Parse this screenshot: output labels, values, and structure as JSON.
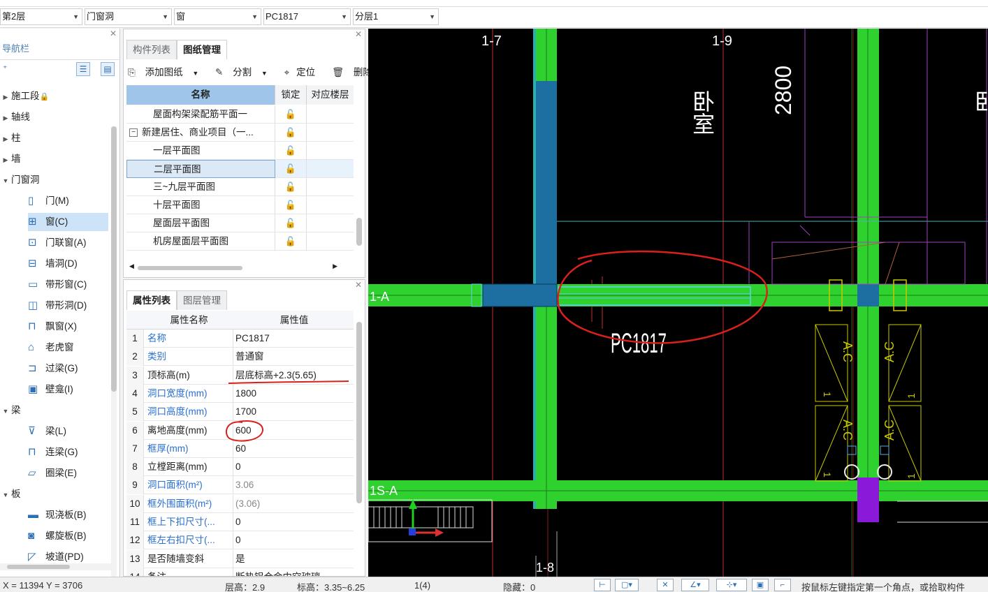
{
  "toolbar": {
    "floor": "第2层",
    "category": "门窗洞",
    "type": "窗",
    "component": "PC1817",
    "layer": "分层1"
  },
  "nav": {
    "title": "导航栏",
    "items": [
      {
        "label": "施工段",
        "expanded": false,
        "icon": "lock-icon"
      },
      {
        "label": "轴线",
        "expanded": false
      },
      {
        "label": "柱",
        "expanded": false
      },
      {
        "label": "墙",
        "expanded": false
      },
      {
        "label": "门窗洞",
        "expanded": true
      },
      {
        "label": "门(M)",
        "icon": "door-icon"
      },
      {
        "label": "窗(C)",
        "icon": "window-icon",
        "selected": true
      },
      {
        "label": "门联窗(A)",
        "icon": "door-window-icon"
      },
      {
        "label": "墙洞(D)",
        "icon": "wall-opening-icon"
      },
      {
        "label": "带形窗(C)",
        "icon": "strip-window-icon"
      },
      {
        "label": "带形洞(D)",
        "icon": "strip-opening-icon"
      },
      {
        "label": "飘窗(X)",
        "icon": "bay-window-icon"
      },
      {
        "label": "老虎窗",
        "icon": "dormer-icon"
      },
      {
        "label": "过梁(G)",
        "icon": "lintel-icon"
      },
      {
        "label": "壁龛(I)",
        "icon": "niche-icon"
      },
      {
        "label": "梁",
        "expanded": true
      },
      {
        "label": "梁(L)",
        "icon": "beam-icon"
      },
      {
        "label": "连梁(G)",
        "icon": "coupling-beam-icon"
      },
      {
        "label": "圈梁(E)",
        "icon": "ring-beam-icon"
      },
      {
        "label": "板",
        "expanded": true
      },
      {
        "label": "现浇板(B)",
        "icon": "slab-icon"
      },
      {
        "label": "螺旋板(B)",
        "icon": "spiral-slab-icon"
      },
      {
        "label": "坡道(PD)",
        "icon": "ramp-icon"
      }
    ]
  },
  "drawing_panel": {
    "tabs": [
      "构件列表",
      "图纸管理"
    ],
    "active_tab": 1,
    "tools": {
      "add": "添加图纸",
      "split": "分割",
      "locate": "定位",
      "delete": "删除"
    },
    "columns": [
      "名称",
      "锁定",
      "对应楼层"
    ],
    "rows": [
      {
        "name": "屋面构架梁配筋平面一",
        "indent": 1
      },
      {
        "name": "新建居住、商业项目（一...",
        "indent": 0,
        "group": true
      },
      {
        "name": "一层平面图",
        "indent": 1
      },
      {
        "name": "二层平面图",
        "indent": 1,
        "selected": true
      },
      {
        "name": "三~九层平面图",
        "indent": 1
      },
      {
        "name": "十层平面图",
        "indent": 1
      },
      {
        "name": "屋面层平面图",
        "indent": 1
      },
      {
        "name": "机房屋面层平面图",
        "indent": 1
      }
    ]
  },
  "prop_panel": {
    "tabs": [
      "属性列表",
      "图层管理"
    ],
    "active_tab": 0,
    "columns": [
      "属性名称",
      "属性值"
    ],
    "rows": [
      {
        "n": "1",
        "name": "名称",
        "value": "PC1817",
        "blue": true
      },
      {
        "n": "2",
        "name": "类别",
        "value": "普通窗",
        "blue": true
      },
      {
        "n": "3",
        "name": "顶标高(m)",
        "value": "层底标高+2.3(5.65)"
      },
      {
        "n": "4",
        "name": "洞口宽度(mm)",
        "value": "1800",
        "blue": true
      },
      {
        "n": "5",
        "name": "洞口高度(mm)",
        "value": "1700",
        "blue": true
      },
      {
        "n": "6",
        "name": "离地高度(mm)",
        "value": "600"
      },
      {
        "n": "7",
        "name": "框厚(mm)",
        "value": "60",
        "blue": true
      },
      {
        "n": "8",
        "name": "立樘距离(mm)",
        "value": "0"
      },
      {
        "n": "9",
        "name": "洞口面积(m²)",
        "value": "3.06",
        "blue": true,
        "gray": true
      },
      {
        "n": "10",
        "name": "框外围面积(m²)",
        "value": "(3.06)",
        "blue": true,
        "gray": true
      },
      {
        "n": "11",
        "name": "框上下扣尺寸(...",
        "value": "0",
        "blue": true
      },
      {
        "n": "12",
        "name": "框左右扣尺寸(...",
        "value": "0",
        "blue": true
      },
      {
        "n": "13",
        "name": "是否随墙变斜",
        "value": "是"
      },
      {
        "n": "14",
        "name": "备注",
        "value": "断热铝合金中空玻璃"
      }
    ]
  },
  "canvas": {
    "axis_labels": [
      "1-7",
      "1-9",
      "1-A",
      "1S-A",
      "1-8"
    ],
    "room_label": "卧室",
    "room_label_right": "卧",
    "dimension": "2800",
    "window_tag": "PC1817",
    "fixture_text": "A.C",
    "fixture_num": "1"
  },
  "status": {
    "coords": "X = 11394 Y = 3706",
    "floor_height": "层高：2.9",
    "elevation": "标高：3.35~6.25",
    "count": "1(4)",
    "hidden": "隐藏：0",
    "hint": "按鼠标左键指定第一个角点，或拾取构件"
  }
}
